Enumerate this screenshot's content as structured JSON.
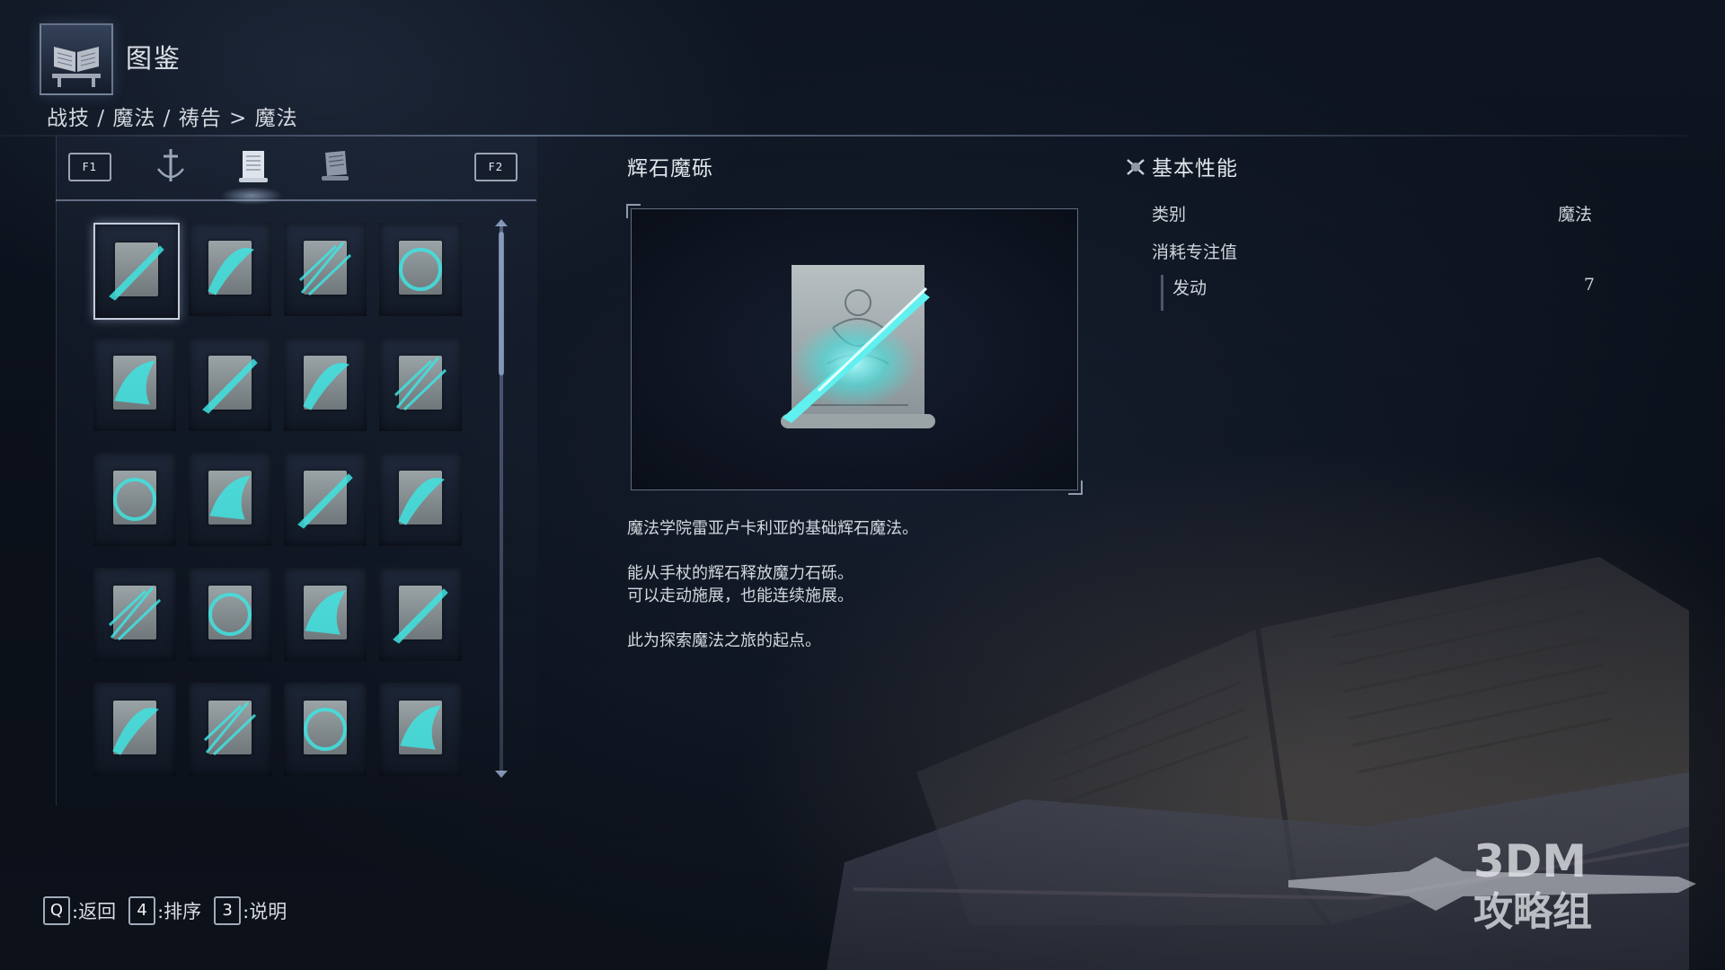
{
  "header": {
    "title": "图鉴",
    "breadcrumb": "战技 / 魔法 / 祷告 > 魔法",
    "icon": "codex-book-icon"
  },
  "tabs": {
    "prev_key": "F1",
    "next_key": "F2",
    "items": [
      {
        "icon": "sword-ash-of-war-icon",
        "active": false
      },
      {
        "icon": "sorcery-scroll-icon",
        "active": true
      },
      {
        "icon": "incantation-seal-icon",
        "active": false
      }
    ]
  },
  "grid": {
    "selected_index": 0,
    "columns": 4,
    "rows": 5
  },
  "detail": {
    "name": "辉石魔砾",
    "description": [
      "魔法学院雷亚卢卡利亚的基础辉石魔法。",
      "能从手杖的辉石释放魔力石砾。",
      "可以走动施展，也能连续施展。",
      "此为探索魔法之旅的起点。"
    ]
  },
  "stats": {
    "title": "基本性能",
    "category_label": "类别",
    "category_value": "魔法",
    "fp_label": "消耗专注值",
    "cast_label": "发动",
    "cast_value": "7"
  },
  "footer": {
    "back_key": "Q",
    "back_label": ":返回",
    "sort_key": "4",
    "sort_label": ":排序",
    "info_key": "3",
    "info_label": ":说明"
  },
  "watermark": {
    "line1": "3DM",
    "line2": "攻略组"
  },
  "colors": {
    "spell_glow": "#3fe3e0",
    "panel_border": "#a0afcd"
  }
}
